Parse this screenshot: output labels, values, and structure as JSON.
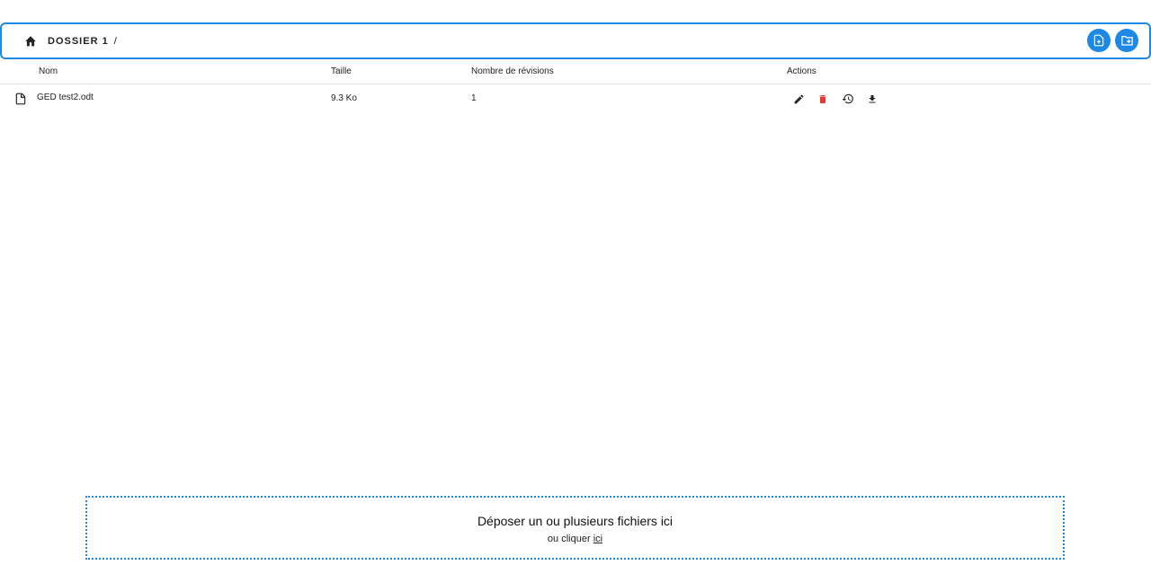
{
  "toolbar": {
    "folder": "DOSSIER 1",
    "separator": "/",
    "accent_color": "#1e88e5",
    "icons": {
      "home": "home-icon",
      "new_file": "file-plus-icon",
      "new_folder": "folder-plus-icon"
    }
  },
  "table": {
    "columns": {
      "name": "Nom",
      "size": "Taille",
      "revisions": "Nombre de révisions",
      "actions": "Actions"
    },
    "rows": [
      {
        "name": "GED test2.odt",
        "size": "9.3 Ko",
        "revisions": "1",
        "icons": [
          "file-icon",
          "edit-icon",
          "delete-icon",
          "history-icon",
          "download-icon"
        ],
        "delete_color": "#e53935"
      }
    ]
  },
  "dropzone": {
    "title": "Déposer un ou plusieurs fichiers ici",
    "subtitle_prefix": "ou cliquer",
    "link": "ici"
  }
}
